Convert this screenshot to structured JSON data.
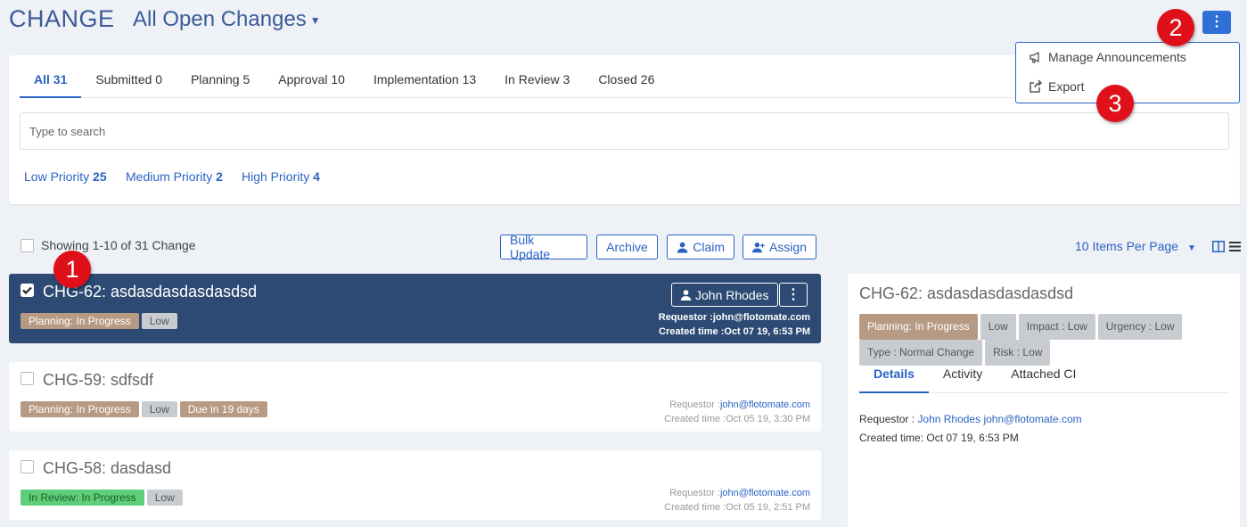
{
  "header": {
    "app_title": "CHANGE",
    "view_title": "All Open Changes"
  },
  "tabs": [
    {
      "label": "All 31"
    },
    {
      "label": "Submitted 0"
    },
    {
      "label": "Planning 5"
    },
    {
      "label": "Approval 10"
    },
    {
      "label": "Implementation 13"
    },
    {
      "label": "In Review 3"
    },
    {
      "label": "Closed 26"
    }
  ],
  "search": {
    "placeholder": "Type to search"
  },
  "priorities": [
    {
      "label": "Low Priority",
      "count": "25"
    },
    {
      "label": "Medium Priority",
      "count": "2"
    },
    {
      "label": "High Priority",
      "count": "4"
    }
  ],
  "menu": {
    "items": [
      {
        "label": "Manage Announcements",
        "icon": "megaphone-icon"
      },
      {
        "label": "Export",
        "icon": "export-icon"
      }
    ]
  },
  "callouts": [
    "1",
    "2",
    "3"
  ],
  "toolbar": {
    "showing": "Showing 1-10 of 31 Change",
    "bulk_update": "Bulk Update",
    "archive": "Archive",
    "claim": "Claim",
    "assign": "Assign",
    "per_page": "10 Items Per Page"
  },
  "rows": [
    {
      "title": "CHG-62: asdasdasdasdasdsd",
      "tags": [
        "Planning: In Progress",
        "Low"
      ],
      "assignee": "John Rhodes",
      "requestor_label": "Requestor :",
      "requestor": "john@flotomate.com",
      "created": "Created time :Oct 07 19, 6:53 PM",
      "selected": true
    },
    {
      "title": "CHG-59: sdfsdf",
      "tags": [
        "Planning: In Progress",
        "Low",
        "Due in 19 days"
      ],
      "requestor_label": "Requestor :",
      "requestor": "john@flotomate.com",
      "created": "Created time :Oct 05 19, 3:30 PM",
      "selected": false
    },
    {
      "title": "CHG-58: dasdasd",
      "tags": [
        "In Review: In Progress",
        "Low"
      ],
      "requestor_label": "Requestor :",
      "requestor": "john@flotomate.com",
      "created": "Created time :Oct 05 19, 2:51 PM",
      "selected": false
    }
  ],
  "detail": {
    "title": "CHG-62: asdasdasdasdasdsd",
    "tags": [
      "Planning: In Progress",
      "Low",
      "Impact : Low",
      "Urgency : Low",
      "Type : Normal Change",
      "Risk : Low"
    ],
    "tabs": [
      "Details",
      "Activity",
      "Attached CI"
    ],
    "requestor_label": "Requestor :",
    "requestor": "John Rhodes john@flotomate.com",
    "created": "Created time: Oct 07 19, 6:53 PM"
  },
  "colors": {
    "accent": "#2b63c4",
    "selected_row": "#2c4a73",
    "callout": "#e0101a"
  }
}
